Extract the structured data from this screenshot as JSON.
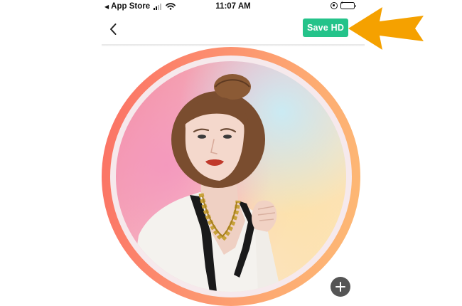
{
  "status_bar": {
    "back_glyph": "◀",
    "carrier": "App Store",
    "time": "11:07 AM",
    "battery_charging": true
  },
  "nav": {
    "save_label": "Save HD"
  },
  "avatar": {
    "frame_gradient": [
      "#fb6f63",
      "#fdbb75"
    ],
    "add_button_icon": "plus-icon"
  },
  "annotation": {
    "arrow_color": "#f5a100"
  },
  "colors": {
    "save_button": "#24c38a",
    "add_button": "#555555"
  }
}
